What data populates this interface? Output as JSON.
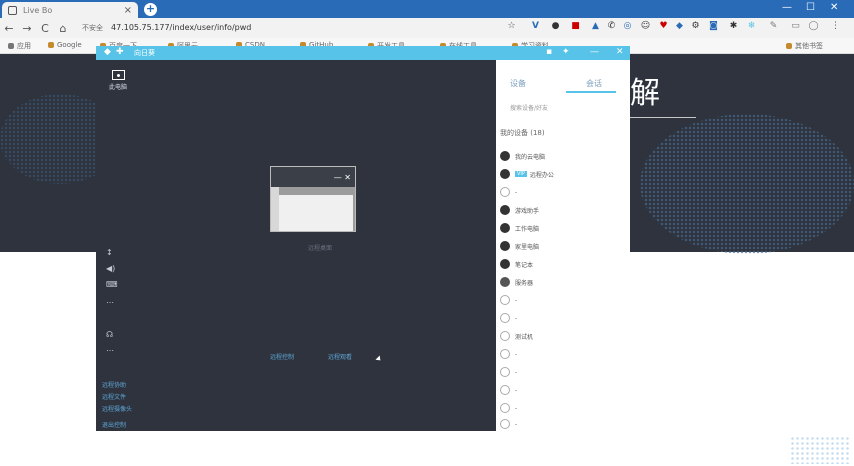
{
  "browser": {
    "tab_title": "Live Bo",
    "tab_close": "×",
    "new_tab": "+",
    "window_url_text": "",
    "address_prefix": "不安全",
    "address_url": "47.105.75.177/index/user/info/pwd",
    "nav_back": "←",
    "nav_forward": "→",
    "nav_reload": "C",
    "nav_home": "⌂",
    "win_min": "—",
    "win_max": "☐",
    "win_close": "✕"
  },
  "bookmarks": [
    {
      "label": "应用"
    },
    {
      "label": "Google"
    },
    {
      "label": "百度一下"
    },
    {
      "label": "阿里云"
    },
    {
      "label": "CSDN"
    },
    {
      "label": "GitHub"
    },
    {
      "label": "开发工具"
    },
    {
      "label": "在线工具"
    },
    {
      "label": "学习资料"
    },
    {
      "label": "其他书签"
    }
  ],
  "banner": {
    "title": "了解",
    "title_visible": "解"
  },
  "remote_window": {
    "title": "向日葵",
    "desktop_icon_label": "此电脑",
    "mini_window_close": "✕",
    "mini_window_min": "—",
    "mini_caption": "远程桌面",
    "bottom_left": [
      "远程协助",
      "远程文件",
      "远程摄像头",
      "退出控制"
    ],
    "bottom_actions": [
      "远程控制",
      "远程观看"
    ]
  },
  "panel": {
    "tabs": [
      "设备",
      "会话"
    ],
    "search_placeholder": "搜索设备/好友",
    "heading": "我的设备 (18)",
    "items": [
      {
        "label": "我的云电脑"
      },
      {
        "tag": "VIP",
        "label": "远程办公"
      },
      {
        "label": "-"
      },
      {
        "label": "游戏助手"
      },
      {
        "label": "工作电脑"
      },
      {
        "label": "家里电脑"
      },
      {
        "label": "笔记本"
      },
      {
        "label": "服务器"
      },
      {
        "label": "-"
      },
      {
        "label": "-"
      },
      {
        "label": "测试机"
      },
      {
        "label": "-"
      },
      {
        "label": "-"
      },
      {
        "label": "-"
      },
      {
        "label": "-"
      },
      {
        "label": "-"
      }
    ]
  }
}
